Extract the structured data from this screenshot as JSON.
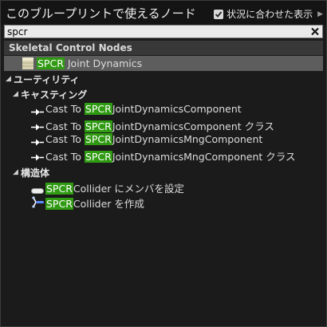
{
  "header": {
    "title": "このブループリントで使えるノード",
    "context_label": "状況に合わせた表示"
  },
  "search": {
    "value": "spcr"
  },
  "highlight": "SPCR",
  "categories": [
    {
      "label": "Skeletal Control Nodes",
      "items": [
        {
          "pre": "",
          "post": " Joint Dynamics"
        }
      ]
    },
    {
      "label": "ユーティリティ",
      "groups": [
        {
          "label": "キャスティング",
          "items": [
            {
              "pre": "Cast To ",
              "post": "JointDynamicsComponent"
            },
            {
              "pre": "Cast To ",
              "post": "JointDynamicsComponent クラス"
            },
            {
              "pre": "Cast To ",
              "post": "JointDynamicsMngComponent"
            },
            {
              "pre": "Cast To ",
              "post": "JointDynamicsMngComponent クラス"
            }
          ]
        },
        {
          "label": "構造体",
          "items": [
            {
              "pre": "",
              "post": "Collider にメンバを設定"
            },
            {
              "pre": "",
              "post": "Collider を作成"
            }
          ]
        }
      ]
    }
  ],
  "colors": {
    "highlight": "#2f9a12",
    "selected_row": "#5d5d5d",
    "category_bar": "#383838"
  }
}
